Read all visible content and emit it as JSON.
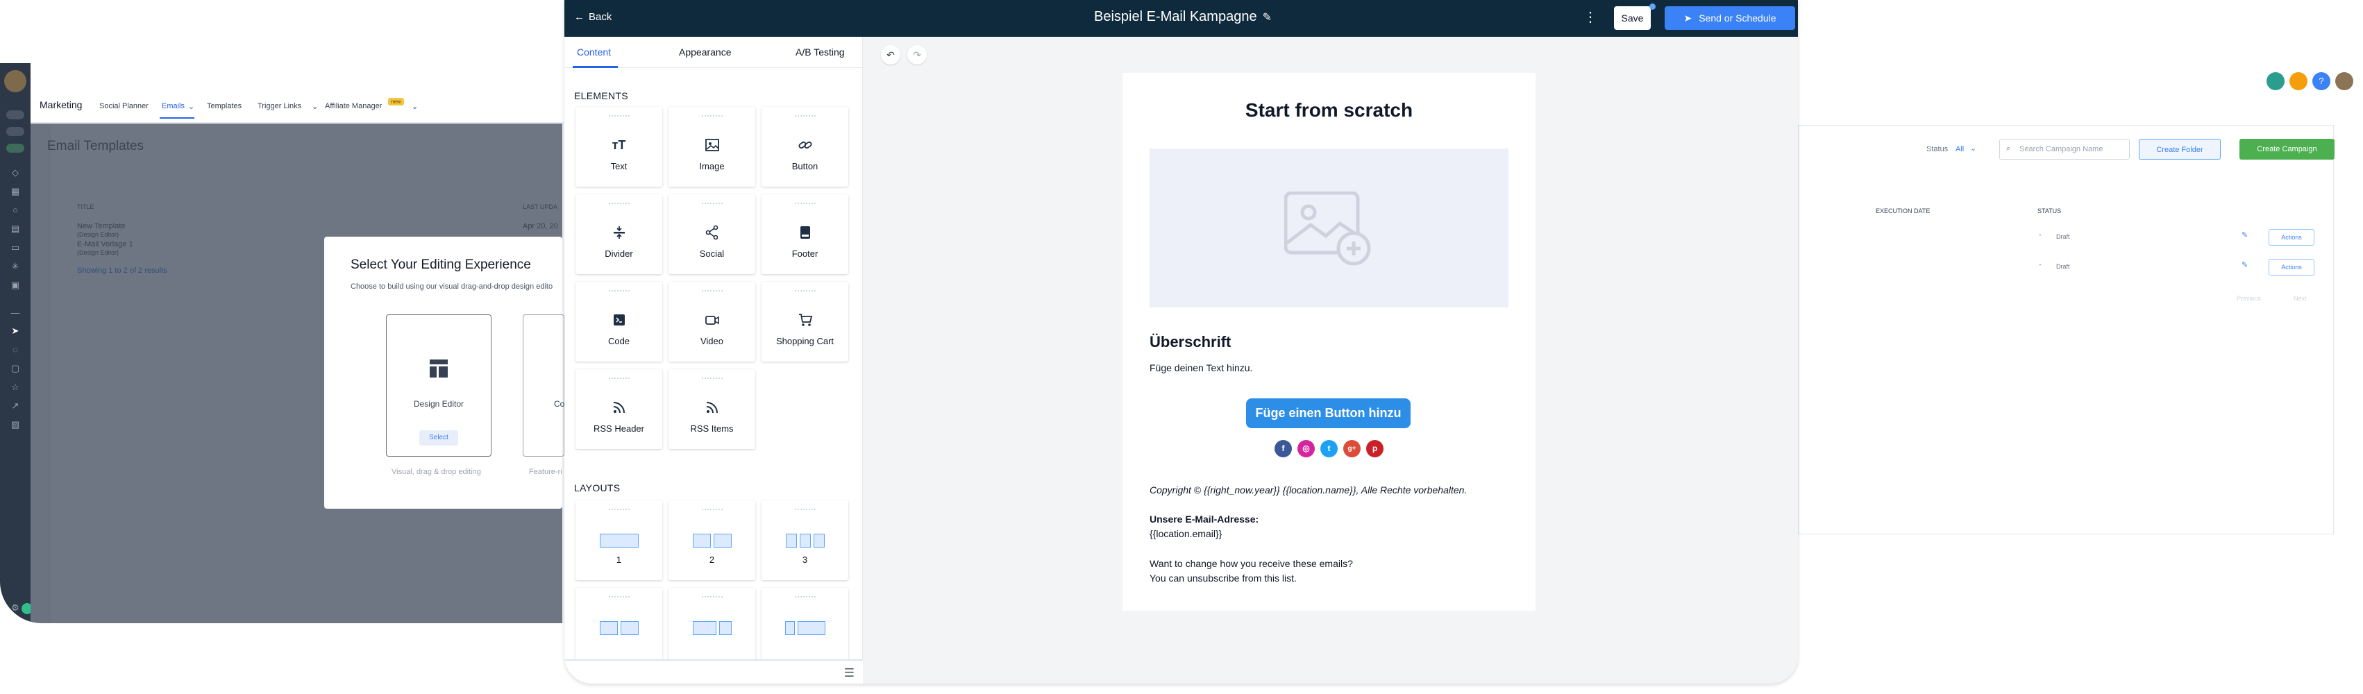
{
  "bg_app": {
    "brand": "Marketing",
    "nav": [
      "Social Planner",
      "Emails",
      "Templates",
      "Trigger Links",
      "Affiliate Manager"
    ],
    "new_badge": "new",
    "page_title": "Email Templates",
    "table_header_title": "TITLE",
    "table_header_updated": "LAST UPDA",
    "rows": [
      {
        "title": "New Template",
        "sub": "(Design Editor)",
        "date": "Apr 20, 20"
      },
      {
        "title": "E-Mail Vorlage 1",
        "sub": "(Design Editor)"
      }
    ],
    "footer_link": "Showing 1 to 2 of 2 results",
    "status_label": "Status",
    "status_value": "All",
    "search_placeholder": "Search Campaign Name",
    "create_folder": "Create Folder",
    "create_campaign": "Create Campaign",
    "col_execution": "EXECUTION DATE",
    "col_status": "STATUS",
    "status_draft": "Draft",
    "actions": "Actions",
    "prev": "Previous",
    "next": "Next"
  },
  "modal": {
    "title": "Select Your Editing Experience",
    "subtitle": "Choose to build using our visual drag-and-drop design edito",
    "design_editor": "Design Editor",
    "select": "Select",
    "foot1": "Visual, drag & drop editing",
    "card2_label": "Co",
    "foot2": "Feature-ri"
  },
  "editor": {
    "back": "Back",
    "title": "Beispiel E-Mail Kampagne",
    "save": "Save",
    "send": "Send or Schedule",
    "tabs": [
      "Content",
      "Appearance",
      "A/B Testing"
    ],
    "elements_label": "ELEMENTS",
    "layouts_label": "LAYOUTS",
    "elements": [
      {
        "label": "Text",
        "icon": "text-icon"
      },
      {
        "label": "Image",
        "icon": "image-icon"
      },
      {
        "label": "Button",
        "icon": "link-icon"
      },
      {
        "label": "Divider",
        "icon": "divider-icon"
      },
      {
        "label": "Social",
        "icon": "share-icon"
      },
      {
        "label": "Footer",
        "icon": "footer-icon"
      },
      {
        "label": "Code",
        "icon": "code-icon"
      },
      {
        "label": "Video",
        "icon": "video-icon"
      },
      {
        "label": "Shopping Cart",
        "icon": "cart-icon"
      },
      {
        "label": "RSS Header",
        "icon": "rss-icon"
      },
      {
        "label": "RSS Items",
        "icon": "rss-icon"
      }
    ],
    "layouts": [
      "1",
      "2",
      "3"
    ]
  },
  "email": {
    "title": "Start from scratch",
    "heading": "Überschrift",
    "paragraph": "Füge deinen Text hinzu.",
    "button": "Füge einen Button hinzu",
    "socials": [
      {
        "name": "facebook",
        "color": "#3b5998",
        "glyph": "f"
      },
      {
        "name": "instagram",
        "color": "#d6249f",
        "glyph": "◎"
      },
      {
        "name": "twitter",
        "color": "#1da1f2",
        "glyph": "t"
      },
      {
        "name": "google-plus",
        "color": "#dd4b39",
        "glyph": "g+"
      },
      {
        "name": "pinterest",
        "color": "#cb2027",
        "glyph": "p"
      }
    ],
    "copyright": "Copyright © {{right_now.year}}  {{location.name}}, Alle Rechte vorbehalten.",
    "address_heading": "Unsere E-Mail-Adresse:",
    "address": "{{location.email}}",
    "unsub1": "Want to change how you receive these emails?",
    "unsub2": "You can unsubscribe from this list."
  },
  "colors": {
    "header_bg": "#0f2a3d",
    "accent": "#2563eb",
    "email_button": "#2d8ee8",
    "create_campaign": "#4caf50"
  }
}
